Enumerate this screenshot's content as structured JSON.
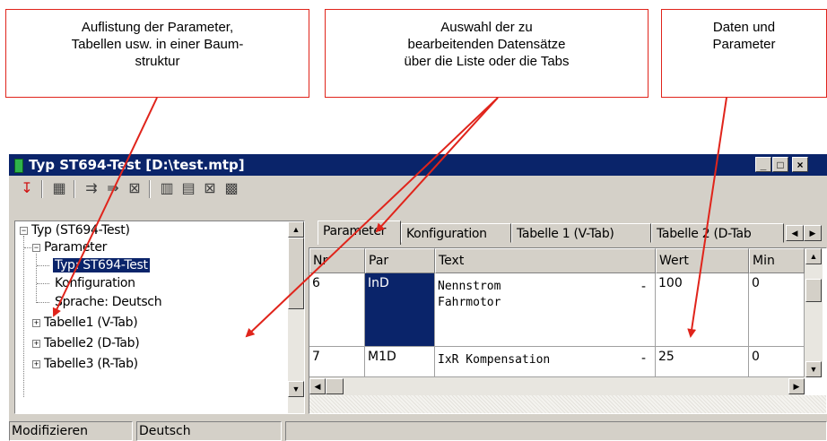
{
  "callouts": {
    "tree": "Auflistung der Parameter,\nTabellen usw. in einer Baum-\nstruktur",
    "selection": "Auswahl der zu\nbearbeitenden Datensätze\nüber die Liste oder die Tabs",
    "data": "Daten und\nParameter"
  },
  "window": {
    "title": "Typ ST694-Test [D:\\test.mtp]",
    "minimize": "_",
    "maximize": "□",
    "close": "×"
  },
  "toolbar": {
    "icons": [
      "download-icon",
      "add-row-icon",
      "insert-row-icon",
      "insert-after-icon",
      "delete-row-icon",
      "add-column-icon",
      "insert-column-icon",
      "delete-column-icon",
      "rename-icon"
    ]
  },
  "tree": {
    "root": "Typ (ST694-Test)",
    "parameter": "Parameter",
    "typ": "Typ: ST694-Test",
    "konfiguration": "Konfiguration",
    "sprache": "Sprache: Deutsch",
    "tabelle1": "Tabelle1 (V-Tab)",
    "tabelle2": "Tabelle2 (D-Tab)",
    "tabelle3": "Tabelle3 (R-Tab)"
  },
  "tabs": [
    "Parameter",
    "Konfiguration",
    "Tabelle 1 (V-Tab)",
    "Tabelle 2 (D-Tab"
  ],
  "grid": {
    "headers": [
      "Nr",
      "Par",
      "Text",
      "Wert",
      "Min"
    ],
    "rows": [
      {
        "nr": "6",
        "par": "InD",
        "text": "Nennstrom\nFahrmotor",
        "dash": "-",
        "wert": "100",
        "min": "0"
      },
      {
        "nr": "7",
        "par": "M1D",
        "text": "IxR Kompensation",
        "dash": "-",
        "wert": "25",
        "min": "0"
      }
    ]
  },
  "status": {
    "mode": "Modifizieren",
    "language": "Deutsch"
  }
}
